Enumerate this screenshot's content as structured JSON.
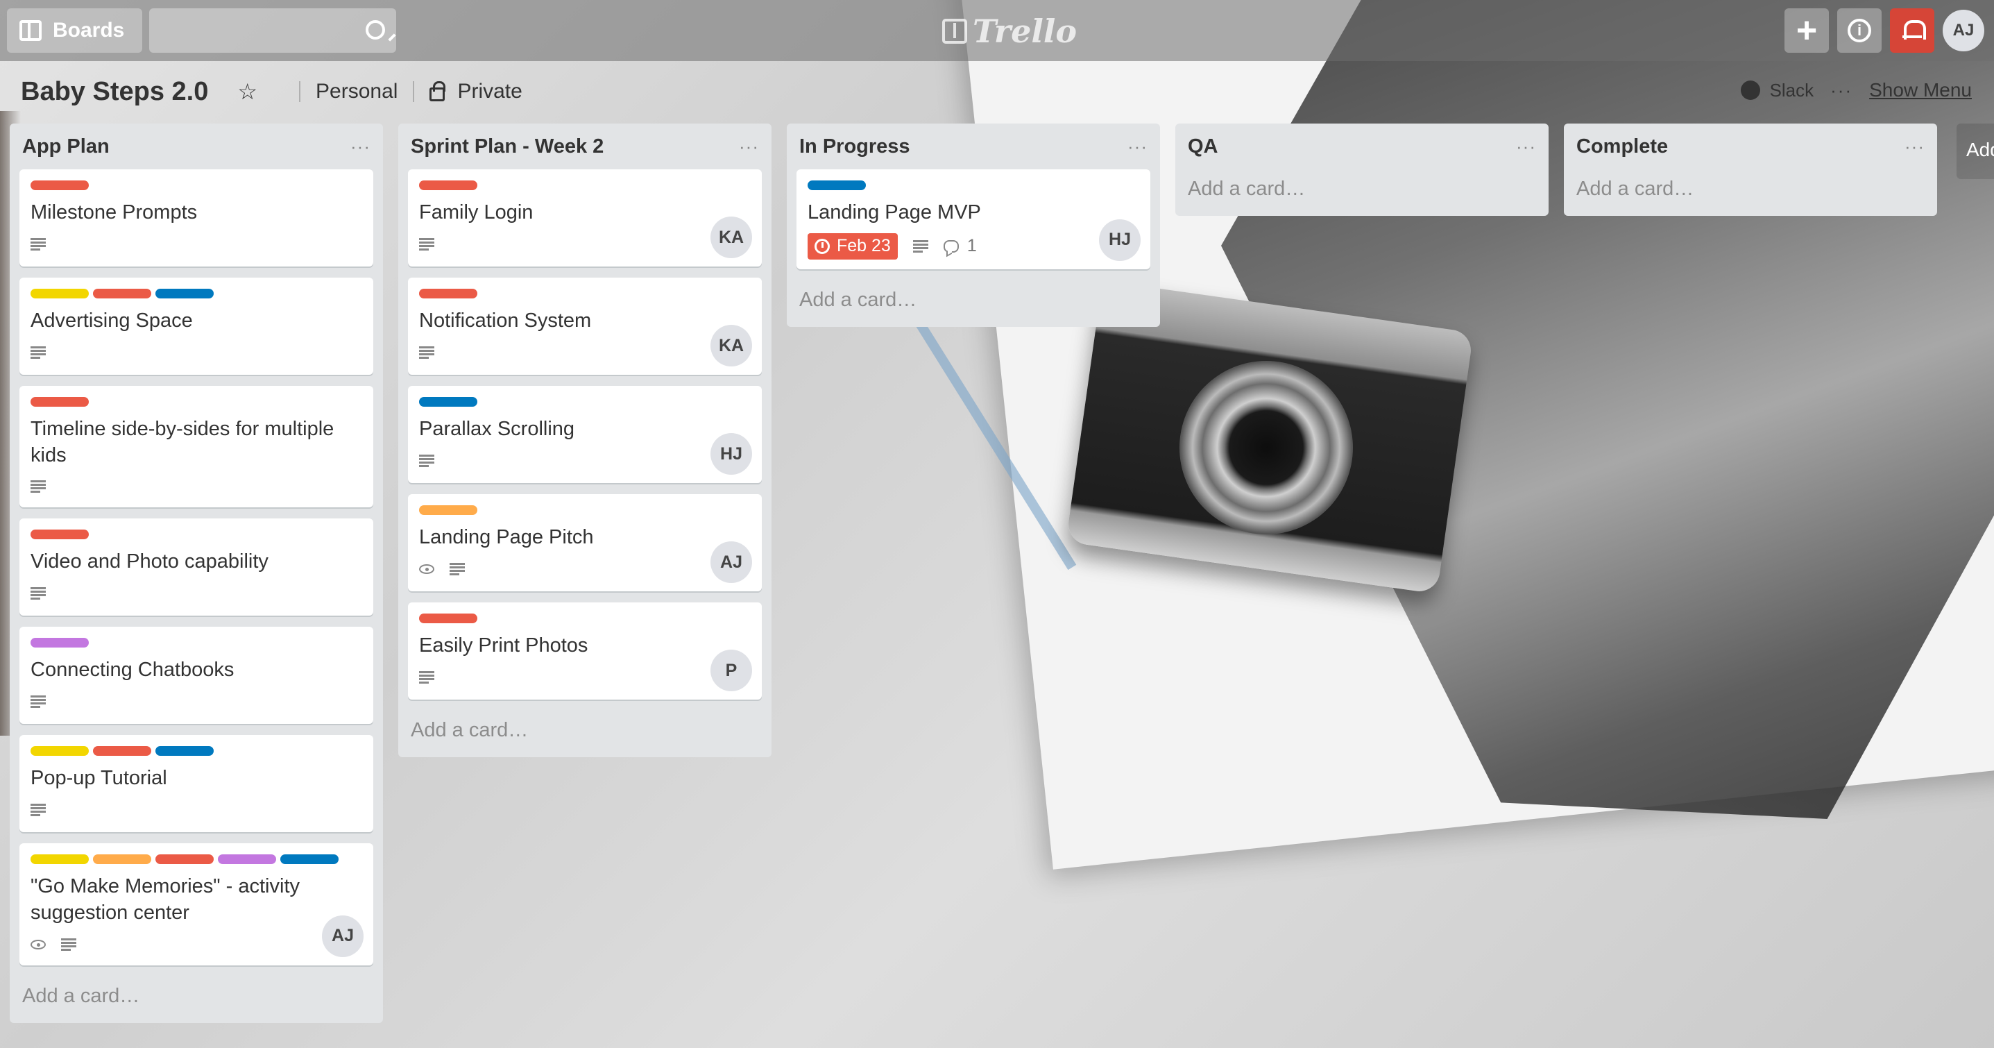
{
  "header": {
    "boards_label": "Boards",
    "search_value": "",
    "logo_text": "Trello",
    "avatar_initials": "AJ"
  },
  "board": {
    "title": "Baby Steps 2.0",
    "team": "Personal",
    "visibility": "Private",
    "power_up": "Slack",
    "show_menu": "Show Menu"
  },
  "colors": {
    "red": "#eb5a46",
    "yellow": "#f2d600",
    "blue": "#0079bf",
    "orange": "#ffab4a",
    "purple": "#c377e0"
  },
  "add_card_label": "Add a card…",
  "add_list_label": "Add",
  "lists": [
    {
      "title": "App Plan",
      "cards": [
        {
          "title": "Milestone Prompts",
          "labels": [
            "red"
          ],
          "badges": [
            "description"
          ],
          "member": ""
        },
        {
          "title": "Advertising Space",
          "labels": [
            "yellow",
            "red",
            "blue"
          ],
          "badges": [
            "description"
          ],
          "member": ""
        },
        {
          "title": "Timeline side-by-sides for multiple kids",
          "labels": [
            "red"
          ],
          "badges": [
            "description"
          ],
          "member": ""
        },
        {
          "title": "Video and Photo capability",
          "labels": [
            "red"
          ],
          "badges": [
            "description"
          ],
          "member": ""
        },
        {
          "title": "Connecting Chatbooks",
          "labels": [
            "purple"
          ],
          "badges": [
            "description"
          ],
          "member": ""
        },
        {
          "title": "Pop-up Tutorial",
          "labels": [
            "yellow",
            "red",
            "blue"
          ],
          "badges": [
            "description"
          ],
          "member": ""
        },
        {
          "title": "\"Go Make Memories\" - activity suggestion center",
          "labels": [
            "yellow",
            "orange",
            "red",
            "purple",
            "blue"
          ],
          "badges": [
            "watch",
            "description"
          ],
          "member": "AJ"
        }
      ]
    },
    {
      "title": "Sprint Plan - Week 2",
      "cards": [
        {
          "title": "Family Login",
          "labels": [
            "red"
          ],
          "badges": [
            "description"
          ],
          "member": "KA"
        },
        {
          "title": "Notification System",
          "labels": [
            "red"
          ],
          "badges": [
            "description"
          ],
          "member": "KA"
        },
        {
          "title": "Parallax Scrolling",
          "labels": [
            "blue"
          ],
          "badges": [
            "description"
          ],
          "member": "HJ"
        },
        {
          "title": "Landing Page Pitch",
          "labels": [
            "orange"
          ],
          "badges": [
            "watch",
            "description"
          ],
          "member": "AJ"
        },
        {
          "title": "Easily Print Photos",
          "labels": [
            "red"
          ],
          "badges": [
            "description"
          ],
          "member": "P"
        }
      ]
    },
    {
      "title": "In Progress",
      "cards": [
        {
          "title": "Landing Page MVP",
          "labels": [
            "blue"
          ],
          "badges": [
            "due",
            "description",
            "comments"
          ],
          "due": "Feb 23",
          "comments": "1",
          "member": "HJ"
        }
      ]
    },
    {
      "title": "QA",
      "cards": []
    },
    {
      "title": "Complete",
      "cards": []
    }
  ]
}
